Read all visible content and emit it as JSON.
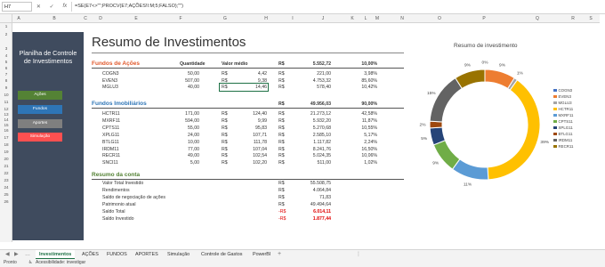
{
  "formula_bar": {
    "name_box": "H7",
    "formula": "=SE(E7<>\"\";PROCV(E7;AÇÕES!I:M;5;FALSO);\"\")"
  },
  "columns": [
    "A",
    "B",
    "C",
    "D",
    "E",
    "F",
    "G",
    "H",
    "I",
    "J",
    "K",
    "L",
    "M",
    "N",
    "O",
    "P",
    "Q",
    "R",
    "S"
  ],
  "rows": [
    "1",
    "2",
    "3",
    "4",
    "5",
    "6",
    "7",
    "8",
    "9",
    "10",
    "11",
    "12",
    "13",
    "14",
    "15",
    "16",
    "17",
    "18",
    "19",
    "20",
    "21",
    "22",
    "23",
    "24",
    "25",
    "26"
  ],
  "sidebar": {
    "title_line1": "Planilha de Controle",
    "title_line2": "de Investimentos",
    "buttons": [
      {
        "label": "Ações",
        "color": "#548235"
      },
      {
        "label": "Fundos",
        "color": "#2e75b6"
      },
      {
        "label": "Aportes",
        "color": "#7f7f7f"
      },
      {
        "label": "Simulação",
        "color": "#ff5050"
      }
    ]
  },
  "main": {
    "title": "Resumo de Investimentos",
    "acoes": {
      "section": "Fundos de Ações",
      "h_qty": "Quantidade",
      "h_avg": "Valor médio",
      "currency": "R$",
      "total": "5.552,72",
      "pct": "10,00%",
      "rows": [
        {
          "ticker": "COGN3",
          "qty": "50,00",
          "cur": "R$",
          "avg": "4,42",
          "cur2": "R$",
          "val": "221,00",
          "pct": "3,98%"
        },
        {
          "ticker": "EVEN3",
          "qty": "507,00",
          "cur": "R$",
          "avg": "9,38",
          "cur2": "R$",
          "val": "4.753,32",
          "pct": "85,60%"
        },
        {
          "ticker": "MGLU3",
          "qty": "40,00",
          "cur": "R$",
          "avg": "14,46",
          "cur2": "R$",
          "val": "578,40",
          "pct": "10,42%"
        }
      ]
    },
    "imob": {
      "section": "Fundos Imobiliários",
      "currency": "R$",
      "total": "49.956,03",
      "pct": "90,00%",
      "rows": [
        {
          "ticker": "HCTR11",
          "qty": "171,00",
          "cur": "R$",
          "avg": "124,40",
          "cur2": "R$",
          "val": "21.273,12",
          "pct": "42,58%"
        },
        {
          "ticker": "MXRF11",
          "qty": "594,00",
          "cur": "R$",
          "avg": "9,99",
          "cur2": "R$",
          "val": "5.932,20",
          "pct": "11,87%"
        },
        {
          "ticker": "CPTS11",
          "qty": "55,00",
          "cur": "R$",
          "avg": "95,83",
          "cur2": "R$",
          "val": "5.270,68",
          "pct": "10,55%"
        },
        {
          "ticker": "XPLG11",
          "qty": "24,00",
          "cur": "R$",
          "avg": "107,71",
          "cur2": "R$",
          "val": "2.585,10",
          "pct": "5,17%"
        },
        {
          "ticker": "BTLG11",
          "qty": "10,00",
          "cur": "R$",
          "avg": "111,78",
          "cur2": "R$",
          "val": "1.117,82",
          "pct": "2,24%"
        },
        {
          "ticker": "IRDM11",
          "qty": "77,00",
          "cur": "R$",
          "avg": "107,04",
          "cur2": "R$",
          "val": "8.241,76",
          "pct": "16,50%"
        },
        {
          "ticker": "RECR11",
          "qty": "49,00",
          "cur": "R$",
          "avg": "102,54",
          "cur2": "R$",
          "val": "5.024,35",
          "pct": "10,06%"
        },
        {
          "ticker": "SNCI11",
          "qty": "5,00",
          "cur": "R$",
          "avg": "102,20",
          "cur2": "R$",
          "val": "511,00",
          "pct": "1,02%"
        }
      ]
    },
    "resumo": {
      "section": "Resumo da conta",
      "rows": [
        {
          "label": "Valor Total Investido",
          "cur": "R$",
          "val": "55.508,75",
          "neg": false
        },
        {
          "label": "Rendimentos",
          "cur": "R$",
          "val": "4.064,84",
          "neg": false
        },
        {
          "label": "Saldo de negociação de ações",
          "cur": "R$",
          "val": "71,83",
          "neg": false
        },
        {
          "label": "Patrimonio atual",
          "cur": "R$",
          "val": "49.494,64",
          "neg": false
        },
        {
          "label": "Saldo Total",
          "cur": "-R$",
          "val": "6.014,11",
          "neg": true
        },
        {
          "label": "Saldo Investido",
          "cur": "-R$",
          "val": "1.877,44",
          "neg": true
        }
      ]
    }
  },
  "chart_data": {
    "type": "pie",
    "title": "Resumo de investimento",
    "categories": [
      "COGN3",
      "EVEN3",
      "MGLU3",
      "HCTR11",
      "MXRF11",
      "CPTS11",
      "XPLG11",
      "BTLG11",
      "IRDM11",
      "RECR11"
    ],
    "values": [
      0,
      9,
      1,
      39,
      11,
      9,
      5,
      2,
      15,
      9
    ],
    "labels": [
      "0%",
      "9%",
      "1%",
      "39%",
      "11%",
      "9%",
      "5%",
      "2%",
      "15%",
      "9%"
    ],
    "colors": [
      "#4472c4",
      "#ed7d31",
      "#a5a5a5",
      "#ffc000",
      "#5b9bd5",
      "#70ad47",
      "#264478",
      "#9e480e",
      "#636363",
      "#997300"
    ],
    "legend": "right"
  },
  "tabs": {
    "items": [
      "Investimentos",
      "AÇÕES",
      "FUNDOS",
      "APORTES",
      "Simulação",
      "Controle de Gastos",
      "PowerBI"
    ],
    "active": "Investimentos",
    "add": "+"
  },
  "status": {
    "ready": "Pronto",
    "accessibility": "Acessibilidade: investigar"
  }
}
